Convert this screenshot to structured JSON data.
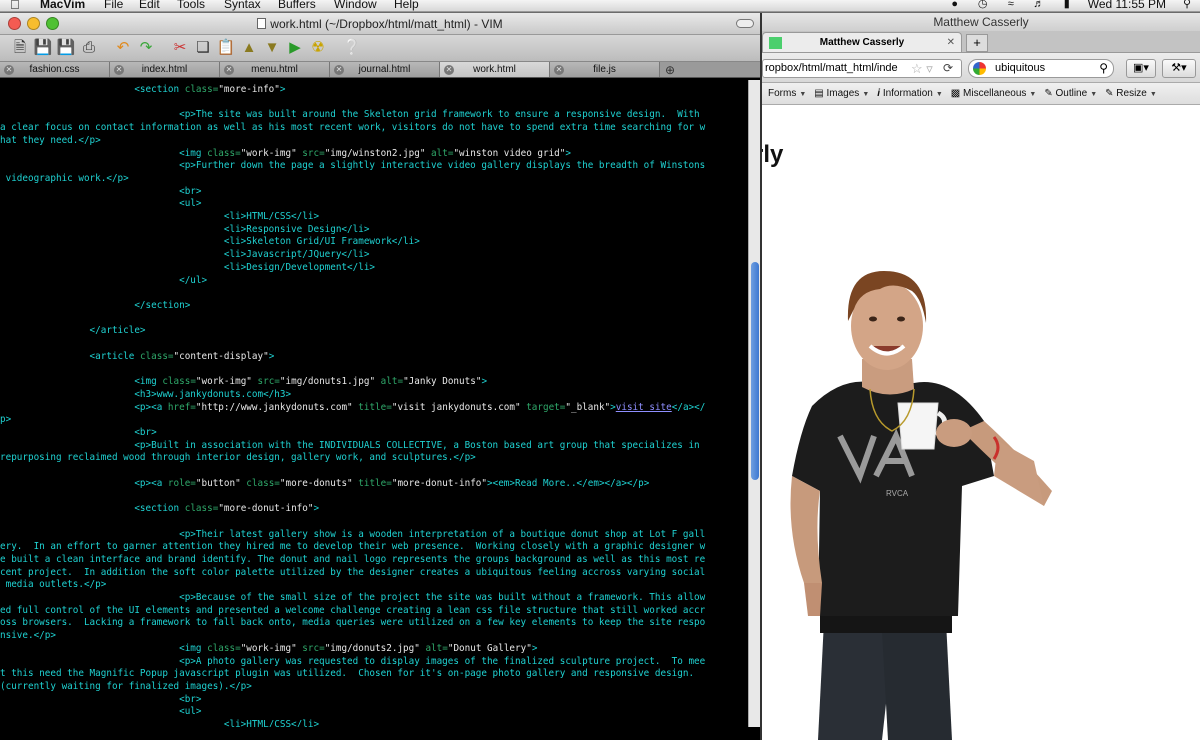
{
  "menubar": {
    "apple": "",
    "app": "MacVim",
    "items": [
      "File",
      "Edit",
      "Tools",
      "Syntax",
      "Buffers",
      "Window",
      "Help"
    ],
    "clock": "Wed 11:55 PM"
  },
  "vim": {
    "title": "work.html (~/Dropbox/html/matt_html) - VIM",
    "tabs": [
      "fashion.css",
      "index.html",
      "menu.html",
      "journal.html",
      "work.html",
      "file.js"
    ],
    "active_tab": 4,
    "toolbar_icons": [
      "open-icon",
      "save-icon",
      "save-all-icon",
      "print-icon",
      "undo-icon",
      "redo-icon",
      "cut-icon",
      "copy-icon",
      "paste-icon",
      "load-session-icon",
      "save-session-icon",
      "run-icon",
      "build-icon",
      "help-icon"
    ]
  },
  "code_lines": [
    [
      {
        "t": "                        <section "
      },
      {
        "a": "class="
      },
      {
        "s": "\"more-info\""
      },
      {
        "t": ">"
      }
    ],
    [
      {
        "t": ""
      }
    ],
    [
      {
        "t": "                                <p>The site was built around the Skeleton grid framework to ensure a responsive design.  With"
      }
    ],
    [
      {
        "t": "a clear focus on contact information as well as his most recent work, visitors do not have to spend extra time searching for w"
      }
    ],
    [
      {
        "t": "hat they need.</p>"
      }
    ],
    [
      {
        "t": "                                <img "
      },
      {
        "a": "class="
      },
      {
        "s": "\"work-img\""
      },
      {
        "a": " src="
      },
      {
        "s": "\"img/winston2.jpg\""
      },
      {
        "a": " alt="
      },
      {
        "s": "\"winston video grid\""
      },
      {
        "t": ">"
      }
    ],
    [
      {
        "t": "                                <p>Further down the page a slightly interactive video gallery displays the breadth of Winstons"
      }
    ],
    [
      {
        "t": " videographic work.</p>"
      }
    ],
    [
      {
        "t": "                                <br>"
      }
    ],
    [
      {
        "t": "                                <ul>"
      }
    ],
    [
      {
        "t": "                                        <li>HTML/CSS</li>"
      }
    ],
    [
      {
        "t": "                                        <li>Responsive Design</li>"
      }
    ],
    [
      {
        "t": "                                        <li>Skeleton Grid/UI Framework</li>"
      }
    ],
    [
      {
        "t": "                                        <li>Javascript/JQuery</li>"
      }
    ],
    [
      {
        "t": "                                        <li>Design/Development</li>"
      }
    ],
    [
      {
        "t": "                                </ul>"
      }
    ],
    [
      {
        "t": ""
      }
    ],
    [
      {
        "t": "                        </section>"
      }
    ],
    [
      {
        "t": ""
      }
    ],
    [
      {
        "t": "                </article>"
      }
    ],
    [
      {
        "t": ""
      }
    ],
    [
      {
        "t": "                <article "
      },
      {
        "a": "class="
      },
      {
        "s": "\"content-display\""
      },
      {
        "t": ">"
      }
    ],
    [
      {
        "t": ""
      }
    ],
    [
      {
        "t": "                        <img "
      },
      {
        "a": "class="
      },
      {
        "s": "\"work-img\""
      },
      {
        "a": " src="
      },
      {
        "s": "\"img/donuts1.jpg\""
      },
      {
        "a": " alt="
      },
      {
        "s": "\"Janky Donuts\""
      },
      {
        "t": ">"
      }
    ],
    [
      {
        "t": "                        <h3>www.jankydonuts.com</h3>"
      }
    ],
    [
      {
        "t": "                        <p><a "
      },
      {
        "a": "href="
      },
      {
        "s": "\"http://www.jankydonuts.com\""
      },
      {
        "a": " title="
      },
      {
        "s": "\"visit jankydonuts.com\""
      },
      {
        "a": " target="
      },
      {
        "s": "\"_blank\""
      },
      {
        "t": ">"
      },
      {
        "l": "visit site"
      },
      {
        "t": "</a></"
      }
    ],
    [
      {
        "t": "p>"
      }
    ],
    [
      {
        "t": "                        <br>"
      }
    ],
    [
      {
        "t": "                        <p>Built in association with the INDIVIDUALS COLLECTIVE, a Boston based art group that specializes in"
      }
    ],
    [
      {
        "t": "repurposing reclaimed wood through interior design, gallery work, and sculptures.</p>"
      }
    ],
    [
      {
        "t": ""
      }
    ],
    [
      {
        "t": "                        <p><a "
      },
      {
        "a": "role="
      },
      {
        "s": "\"button\""
      },
      {
        "a": " class="
      },
      {
        "s": "\"more-donuts\""
      },
      {
        "a": " title="
      },
      {
        "s": "\"more-donut-info\""
      },
      {
        "t": "><em>Read More..</em></a></p>"
      }
    ],
    [
      {
        "t": ""
      }
    ],
    [
      {
        "t": "                        <section "
      },
      {
        "a": "class="
      },
      {
        "s": "\"more-donut-info\""
      },
      {
        "t": ">"
      }
    ],
    [
      {
        "t": ""
      }
    ],
    [
      {
        "t": "                                <p>Their latest gallery show is a wooden interpretation of a boutique donut shop at Lot F gall"
      }
    ],
    [
      {
        "t": "ery.  In an effort to garner attention they hired me to develop their web presence.  Working closely with a graphic designer w"
      }
    ],
    [
      {
        "t": "e built a clean interface and brand identify. The donut and nail logo represents the groups background as well as this most re"
      }
    ],
    [
      {
        "t": "cent project.  In addition the soft color palette utilized by the designer creates a ubiquitous feeling accross varying social"
      }
    ],
    [
      {
        "t": " media outlets.</p>"
      }
    ],
    [
      {
        "t": "                                <p>Because of the small size of the project the site was built without a framework. This allow"
      }
    ],
    [
      {
        "t": "ed full control of the UI elements and presented a welcome challenge creating a lean css file structure that still worked accr"
      }
    ],
    [
      {
        "t": "oss browsers.  Lacking a framework to fall back onto, media queries were utilized on a few key elements to keep the site respo"
      }
    ],
    [
      {
        "t": "nsive.</p>"
      }
    ],
    [
      {
        "t": "                                <img "
      },
      {
        "a": "class="
      },
      {
        "s": "\"work-img\""
      },
      {
        "a": " src="
      },
      {
        "s": "\"img/donuts2.jpg\""
      },
      {
        "a": " alt="
      },
      {
        "s": "\"Donut Gallery\""
      },
      {
        "t": ">"
      }
    ],
    [
      {
        "t": "                                <p>A photo gallery was requested to display images of the finalized sculpture project.  To mee"
      }
    ],
    [
      {
        "t": "t this need the Magnific Popup javascript plugin was utilized.  Chosen for it's on-page photo gallery and responsive design."
      }
    ],
    [
      {
        "t": "(currently waiting for finalized images).</p>"
      }
    ],
    [
      {
        "t": "                                <br>"
      }
    ],
    [
      {
        "t": "                                <ul>"
      }
    ],
    [
      {
        "t": "                                        <li>HTML/CSS</li>"
      }
    ]
  ],
  "browser": {
    "title": "Matthew Casserly",
    "tab_label": "Matthew Casserly",
    "url": "ropbox/html/matt_html/inde",
    "search": "ubiquitous",
    "devbar": [
      "Forms",
      "Images",
      "Information",
      "Miscellaneous",
      "Outline",
      "Resize"
    ],
    "page_heading": "rly"
  },
  "colors": {
    "code_text": "#1fd2d2",
    "code_attr": "#2fa86a",
    "code_bg": "#000000",
    "scroll_thumb": "#3d78d1"
  }
}
